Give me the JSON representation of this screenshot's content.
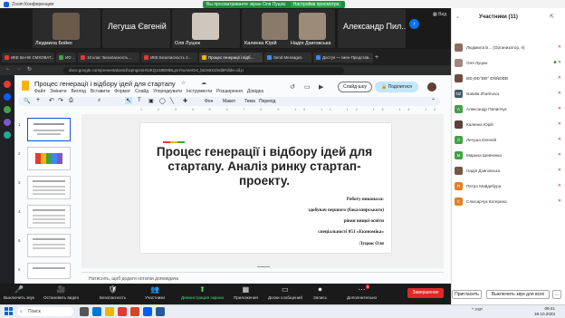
{
  "zoom": {
    "title": "Zoom Конференция",
    "share_banner": "Вы просматриваете экран Оля Луцюк",
    "view_options": "Настройки просмотра",
    "view_label": "Вид",
    "tiles": [
      {
        "name": "Людмила Бойко",
        "kind": "photo"
      },
      {
        "name": "Легуша Євгеній",
        "kind": "big"
      },
      {
        "name": "Оля Луцюк",
        "kind": "photo"
      },
      {
        "name": "Калинка Юрій",
        "kind": "photo"
      },
      {
        "name": "Надія Дзиговська",
        "kind": "photo"
      },
      {
        "name": "Александр Пил...",
        "kind": "big"
      }
    ],
    "controls": [
      {
        "label": "Выключить звук",
        "icon": "🎤"
      },
      {
        "label": "Остановить видео",
        "icon": "🎥"
      },
      {
        "label": "Безопасность",
        "icon": "🛡"
      },
      {
        "label": "Участники",
        "icon": "👥"
      },
      {
        "label": "Демонстрация экрана",
        "icon": "⬆"
      },
      {
        "label": "Приложения",
        "icon": "▦"
      },
      {
        "label": "Доски сообщений",
        "icon": "▭"
      },
      {
        "label": "Запись",
        "icon": "⏺"
      },
      {
        "label": "Дополнительно",
        "icon": "⋯"
      }
    ],
    "end_label": "Завершение",
    "participants_count": "5"
  },
  "browser": {
    "tabs": [
      {
        "label": "ИКЕ 8а-НЕ СМХОВАТ...",
        "color": "#e53935"
      },
      {
        "label": "ИО ..",
        "color": "#43a047"
      },
      {
        "label": "10 клас 'Безопасность...",
        "color": "#e53935"
      },
      {
        "label": "ИКЕ Безопасность 2...",
        "color": "#e53935"
      },
      {
        "label": "Процес генерації і відб...",
        "color": "#f4b400",
        "active": true
      },
      {
        "label": "Send Messages",
        "color": "#4285f4"
      },
      {
        "label": "Доступ — Імен-Представ...",
        "color": "#4285f4"
      }
    ],
    "url": "docs.google.com/presentation/d/1qmgxmHlUKQ1S8EMBLpxYtuAseOxt_bIcN6X2/edit#slide=id.p"
  },
  "slides": {
    "doc_title": "Процес генерації і відбору ідей для стартапу",
    "menu": [
      "Файл",
      "Змінити",
      "Вигляд",
      "Вставити",
      "Формат",
      "Слайд",
      "Упорядкувати",
      "Інструменти",
      "Розширення",
      "Довідка"
    ],
    "toolbar": [
      "Фон",
      "Макет",
      "Тема",
      "Перехід"
    ],
    "slideshow_label": "Слайд-шоу",
    "share_label": "Поділитися",
    "slide_numbers": [
      "1",
      "2",
      "3",
      "4",
      "5",
      "6"
    ],
    "ruler": "1 2 3 4 5 6 7 8 9 10 11 12 13 14 15 16 17 18 19 20 21 22 23 24 25",
    "main_title": "Процес генерації і відбору ідей для стартапу. Аналіз ринку стартап-проекту.",
    "body_lines": [
      "Роботу виконала:",
      "здобувач першого (бакалаврського)",
      "рівня вищої освіти",
      "спеціальності 051 «Економіка»",
      "Луцюк Оля"
    ],
    "notes_placeholder": "Натисніть, щоб додати нотатки доповідача",
    "accent_colors": [
      "#e53935",
      "#f4b400",
      "#43a047"
    ]
  },
  "participants": {
    "title": "Участники (11)",
    "list": [
      {
        "name": "Людмила Б... (Организатор, я)",
        "avatar": "photo",
        "color": "#8d6e63"
      },
      {
        "name": "Оля Луцюк",
        "avatar": "photo",
        "color": "#a1887f"
      },
      {
        "name": "ÐÐ¸ÐÐ°ÐÐ° ÐÑÑÐÐÐ",
        "avatar": "photo",
        "color": "#6d4c41"
      },
      {
        "name": "Natalia Zharinova",
        "avatar": "NZ",
        "color": "#455a64"
      },
      {
        "name": "Александр Пилипчук",
        "avatar": "A",
        "color": "#43a047"
      },
      {
        "name": "Калинка Юрій",
        "avatar": "photo",
        "color": "#5d4037"
      },
      {
        "name": "Легуша Євгеній",
        "avatar": "Л",
        "color": "#43a047"
      },
      {
        "name": "Марина Шевченко",
        "avatar": "М",
        "color": "#43a047"
      },
      {
        "name": "Надія Дзиговська",
        "avatar": "photo",
        "color": "#795548"
      },
      {
        "name": "Петро Майдебура",
        "avatar": "П",
        "color": "#e67e22"
      },
      {
        "name": "Слюсарчук Катерина",
        "avatar": "С",
        "color": "#e67e22"
      }
    ],
    "invite_label": "Пригласить",
    "mute_all_label": "Выключить звук для всех",
    "more_label": "..."
  },
  "taskbar": {
    "search": "Поиск",
    "tray": "^  УКР",
    "time": "09:41",
    "date": "18.10.2023"
  }
}
